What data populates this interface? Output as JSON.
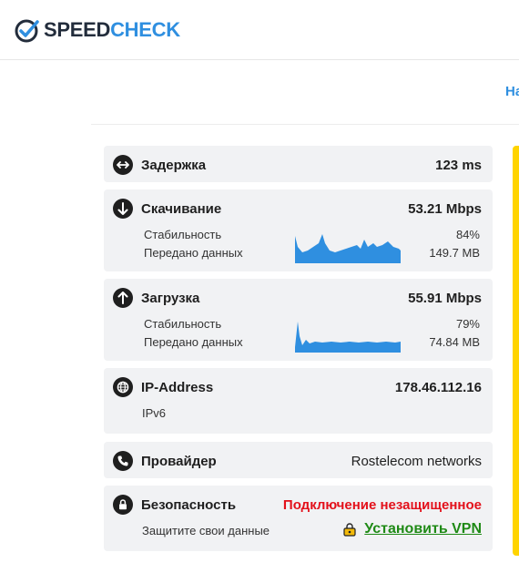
{
  "header": {
    "logo_speed": "SPEED",
    "logo_check": "CHECK",
    "nav_partial": "На"
  },
  "cards": {
    "latency": {
      "label": "Задержка",
      "value": "123 ms",
      "icon": "arrows-horizontal-icon"
    },
    "download": {
      "label": "Скачивание",
      "value": "53.21 Mbps",
      "icon": "arrow-down-icon",
      "stability_label": "Стабильность",
      "stability_value": "84%",
      "transferred_label": "Передано данных",
      "transferred_value": "149.7 MB"
    },
    "upload": {
      "label": "Загрузка",
      "value": "55.91 Mbps",
      "icon": "arrow-up-icon",
      "stability_label": "Стабильность",
      "stability_value": "79%",
      "transferred_label": "Передано данных",
      "transferred_value": "74.84 MB"
    },
    "ip": {
      "label": "IP-Address",
      "value": "178.46.112.16",
      "sub": "IPv6",
      "icon": "globe-icon"
    },
    "provider": {
      "label": "Провайдер",
      "value": "Rostelecom networks",
      "icon": "phone-icon"
    },
    "security": {
      "label": "Безопасность",
      "value": "Подключение незащищенное",
      "icon": "lock-icon",
      "sub": "Защитите свои данные",
      "vpn_label": "Установить VPN"
    }
  },
  "colors": {
    "accent": "#2f8fe0",
    "danger": "#e3101a",
    "vpn": "#1f8a16",
    "chart": "#2f8fe0",
    "highlight": "#ffd400"
  }
}
